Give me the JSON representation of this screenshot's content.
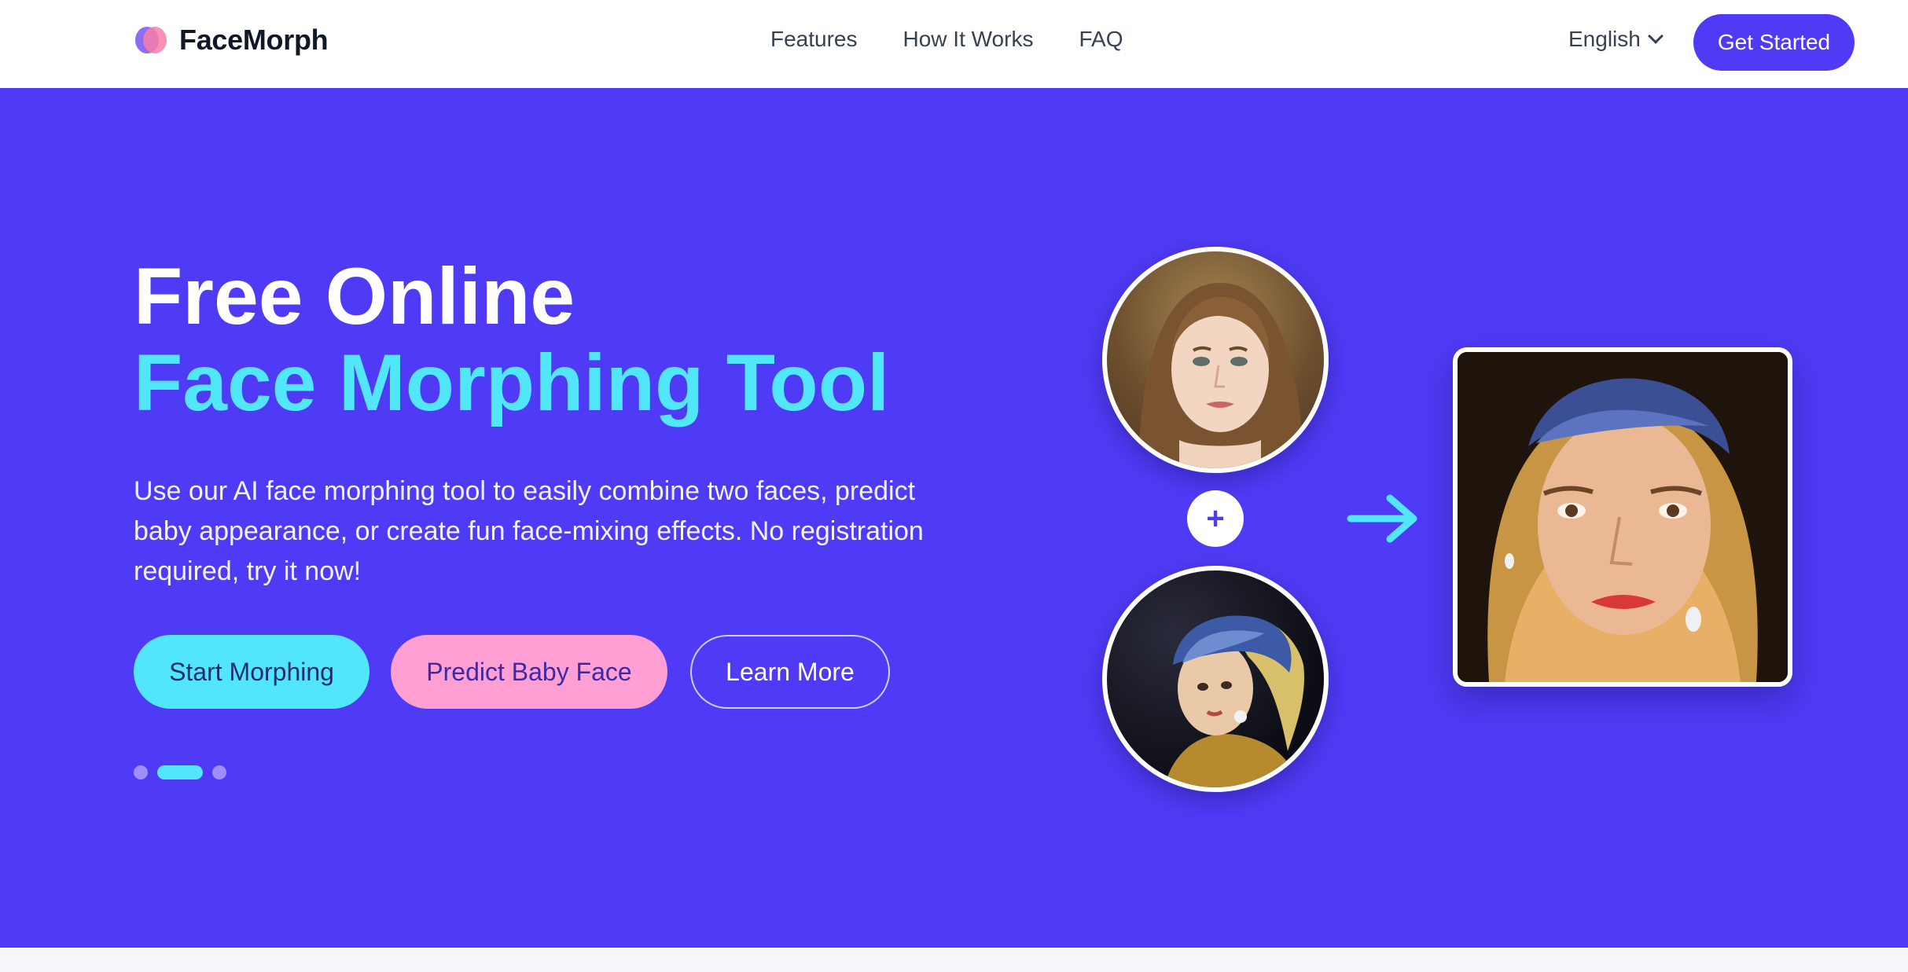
{
  "nav": {
    "brand": "FaceMorph",
    "links": [
      "Features",
      "How It Works",
      "FAQ"
    ],
    "language": "English",
    "cta": "Get Started"
  },
  "hero": {
    "title_line1": "Free Online",
    "title_line2": "Face Morphing Tool",
    "description": "Use our AI face morphing tool to easily combine two faces, predict baby appearance, or create fun face-mixing effects. No registration required, try it now!",
    "buttons": {
      "primary": "Start Morphing",
      "secondary": "Predict Baby Face",
      "tertiary": "Learn More"
    },
    "carousel": {
      "slides": 3,
      "active_index": 1
    },
    "plus_symbol": "+"
  },
  "colors": {
    "hero_bg": "#4f3bf5",
    "accent_cyan": "#52e6fb",
    "accent_pink": "#ff9fd3",
    "nav_cta": "#4f3bf5"
  },
  "icons": {
    "logo": "two-overlapping-circles-logo",
    "language": "chevron-down-icon",
    "arrow": "arrow-right-icon"
  }
}
